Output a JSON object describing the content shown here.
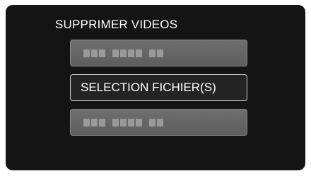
{
  "dialog": {
    "title": "SUPPRIMER VIDEOS",
    "options": [
      {
        "label": "",
        "state": "disabled"
      },
      {
        "label": "SELECTION FICHIER(S)",
        "state": "active"
      },
      {
        "label": "",
        "state": "disabled"
      }
    ]
  },
  "colors": {
    "background": "#141414",
    "disabled_button": "#666666",
    "active_border": "#cfcfcf"
  }
}
